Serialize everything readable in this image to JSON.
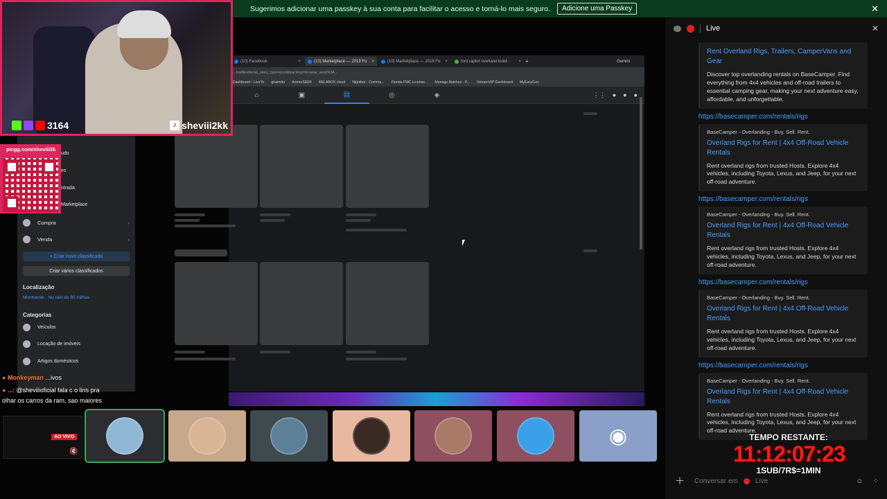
{
  "banner": {
    "text": "Sugerimos adicionar uma passkey à sua conta para facilitar o acesso e torná-lo mais seguro.",
    "button": "Adicione uma Passkey"
  },
  "webcam": {
    "viewer_count": "3164",
    "handle": "sheviii2kk"
  },
  "qr": {
    "url": "pixgg.com/sheviii2k"
  },
  "browser": {
    "tabs": [
      "(10) Facebook",
      "(10) Marketplace — 2019 Fo",
      "(10) Marketplace — 2018 Fo",
      "ford raptor overland build -"
    ],
    "gemini": "Gemini",
    "url": "...mall&referral_story_type=post&tracking=browse_serp%3A...",
    "bookmarks": [
      "Dashboard - LiveYo",
      "giraimão",
      "AmmoSEEK",
      "BELABOX cloud",
      "Nightbot - Comma...",
      "Florida FWC License...",
      "Manage Batches - P...",
      "StreamVIP Dashboard",
      "MyEasyGov"
    ]
  },
  "fb_sidebar": {
    "ghost_items": [
      "udo",
      "es",
      "ntrada",
      "Marketplace"
    ],
    "compra": "Compra",
    "venda": "Venda",
    "create_button": "+ Criar novo classificado",
    "create_multiple": "Criar vários classificados",
    "location_heading": "Localização",
    "location_value": "Montverde · No raio de 80 milhas",
    "categories_heading": "Categorias",
    "categories": [
      "Veículos",
      "Locação de imóveis",
      "Artigos domésticos",
      "...ivos"
    ]
  },
  "overlay_chat": {
    "line1_name": "Monkeyman",
    "line1_text": "...ivos",
    "line2_name": "...",
    "line2_text": ": @sheviiioficial fala c o lins pra",
    "line3_text": "olhar os carros da ram, sao maiores"
  },
  "call": {
    "live_badge": "AO VIVO"
  },
  "panel": {
    "title": "Live",
    "messages": [
      {
        "link": "",
        "provider": "",
        "title": "Rent Overland Rigs, Trailers, CamperVans and Gear",
        "desc": "Discover top overlanding rentals on BaseCamper. Find everything from 4x4 vehicles and off-road trailers to essential camping gear, making your next adventure easy, affordable, and unforgettable."
      },
      {
        "link": "https://basecamper.com/rentals/rigs",
        "provider": "BaseCamper - Overlanding - Buy. Sell. Rent.",
        "title": "Overland Rigs for Rent | 4x4 Off-Road Vehicle Rentals",
        "desc": "Rent overland rigs from trusted Hosts. Explore 4x4 vehicles, including Toyota, Lexus, and Jeep, for your next off-road adventure."
      },
      {
        "link": "https://basecamper.com/rentals/rigs",
        "provider": "BaseCamper - Overlanding - Buy. Sell. Rent.",
        "title": "Overland Rigs for Rent | 4x4 Off-Road Vehicle Rentals",
        "desc": "Rent overland rigs from trusted Hosts. Explore 4x4 vehicles, including Toyota, Lexus, and Jeep, for your next off-road adventure."
      },
      {
        "link": "https://basecamper.com/rentals/rigs",
        "provider": "BaseCamper - Overlanding - Buy. Sell. Rent.",
        "title": "Overland Rigs for Rent | 4x4 Off-Road Vehicle Rentals",
        "desc": "Rent overland rigs from trusted Hosts. Explore 4x4 vehicles, including Toyota, Lexus, and Jeep, for your next off-road adventure."
      },
      {
        "link": "https://basecamper.com/rentals/rigs",
        "provider": "BaseCamper - Overlanding - Buy. Sell. Rent.",
        "title": "Overland Rigs for Rent | 4x4 Off-Road Vehicle Rentals",
        "desc": "Rent overland rigs from trusted Hosts. Explore 4x4 vehicles, including Toyota, Lexus, and Jeep, for your next off-road adventure."
      }
    ],
    "composer_placeholder": "Conversar em",
    "composer_channel": "Live"
  },
  "timer": {
    "label": "TEMPO RESTANTE:",
    "time": "11:12:07:23",
    "rate": "1SUB/7R$=1MIN"
  },
  "colors": {
    "accent_blue": "#2d88ff",
    "link_blue": "#4a9eff",
    "live_red": "#e02020",
    "webcam_border": "#e0245e",
    "banner_green": "#0b3b1e"
  }
}
